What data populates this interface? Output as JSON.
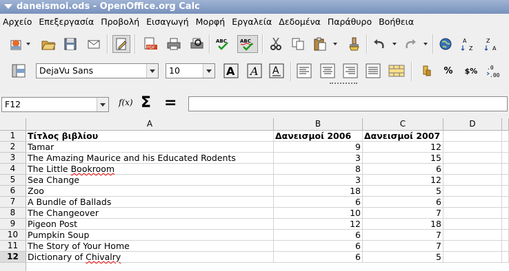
{
  "window": {
    "title": "daneismoi.ods - OpenOffice.org Calc"
  },
  "menu": [
    "Αρχείο",
    "Επεξεργασία",
    "Προβολή",
    "Εισαγωγή",
    "Μορφή",
    "Εργαλεία",
    "Δεδομένα",
    "Παράθυρο",
    "Βοήθεια"
  ],
  "format_toolbar": {
    "font_name": "DejaVu Sans",
    "font_size": "10",
    "bold_glyph": "A",
    "italic_glyph": "A",
    "underline_glyph": "A",
    "percent_glyph": "%",
    "currency_glyph": "$%",
    "pdf_label": "PDF"
  },
  "formula_bar": {
    "name_box": "F12",
    "function_wizard": "f(x)",
    "sum_glyph": "Σ",
    "equals_glyph": "=",
    "input_value": ""
  },
  "sheet": {
    "columns": [
      "A",
      "B",
      "C",
      "D"
    ],
    "rows": [
      {
        "n": "1",
        "a": "Τίτλος βιβλίου",
        "b": "Δανεισμοί 2006",
        "c": "Δανεισμοί 2007"
      },
      {
        "n": "2",
        "a": "Tamar",
        "b": "9",
        "c": "12"
      },
      {
        "n": "3",
        "a": "The Amazing Maurice and his Educated Rodents",
        "b": "3",
        "c": "15"
      },
      {
        "n": "4",
        "a": "The Little Bookroom",
        "b": "8",
        "c": "6"
      },
      {
        "n": "5",
        "a": "Sea Change",
        "b": "3",
        "c": "12"
      },
      {
        "n": "6",
        "a": "Zoo",
        "b": "18",
        "c": "5"
      },
      {
        "n": "7",
        "a": "A Bundle of Ballads",
        "b": "6",
        "c": "6"
      },
      {
        "n": "8",
        "a": "The Changeover",
        "b": "10",
        "c": "7"
      },
      {
        "n": "9",
        "a": "Pigeon Post",
        "b": "12",
        "c": "18"
      },
      {
        "n": "10",
        "a": "Pumpkin Soup",
        "b": "6",
        "c": "7"
      },
      {
        "n": "11",
        "a": "The Story of Your Home",
        "b": "6",
        "c": "7"
      },
      {
        "n": "12",
        "a": "Dictionary of Chivalry",
        "b": "6",
        "c": "5"
      }
    ],
    "selected_row": "12",
    "spellcheck_words": [
      "Bookroom",
      "Chivalry"
    ]
  }
}
